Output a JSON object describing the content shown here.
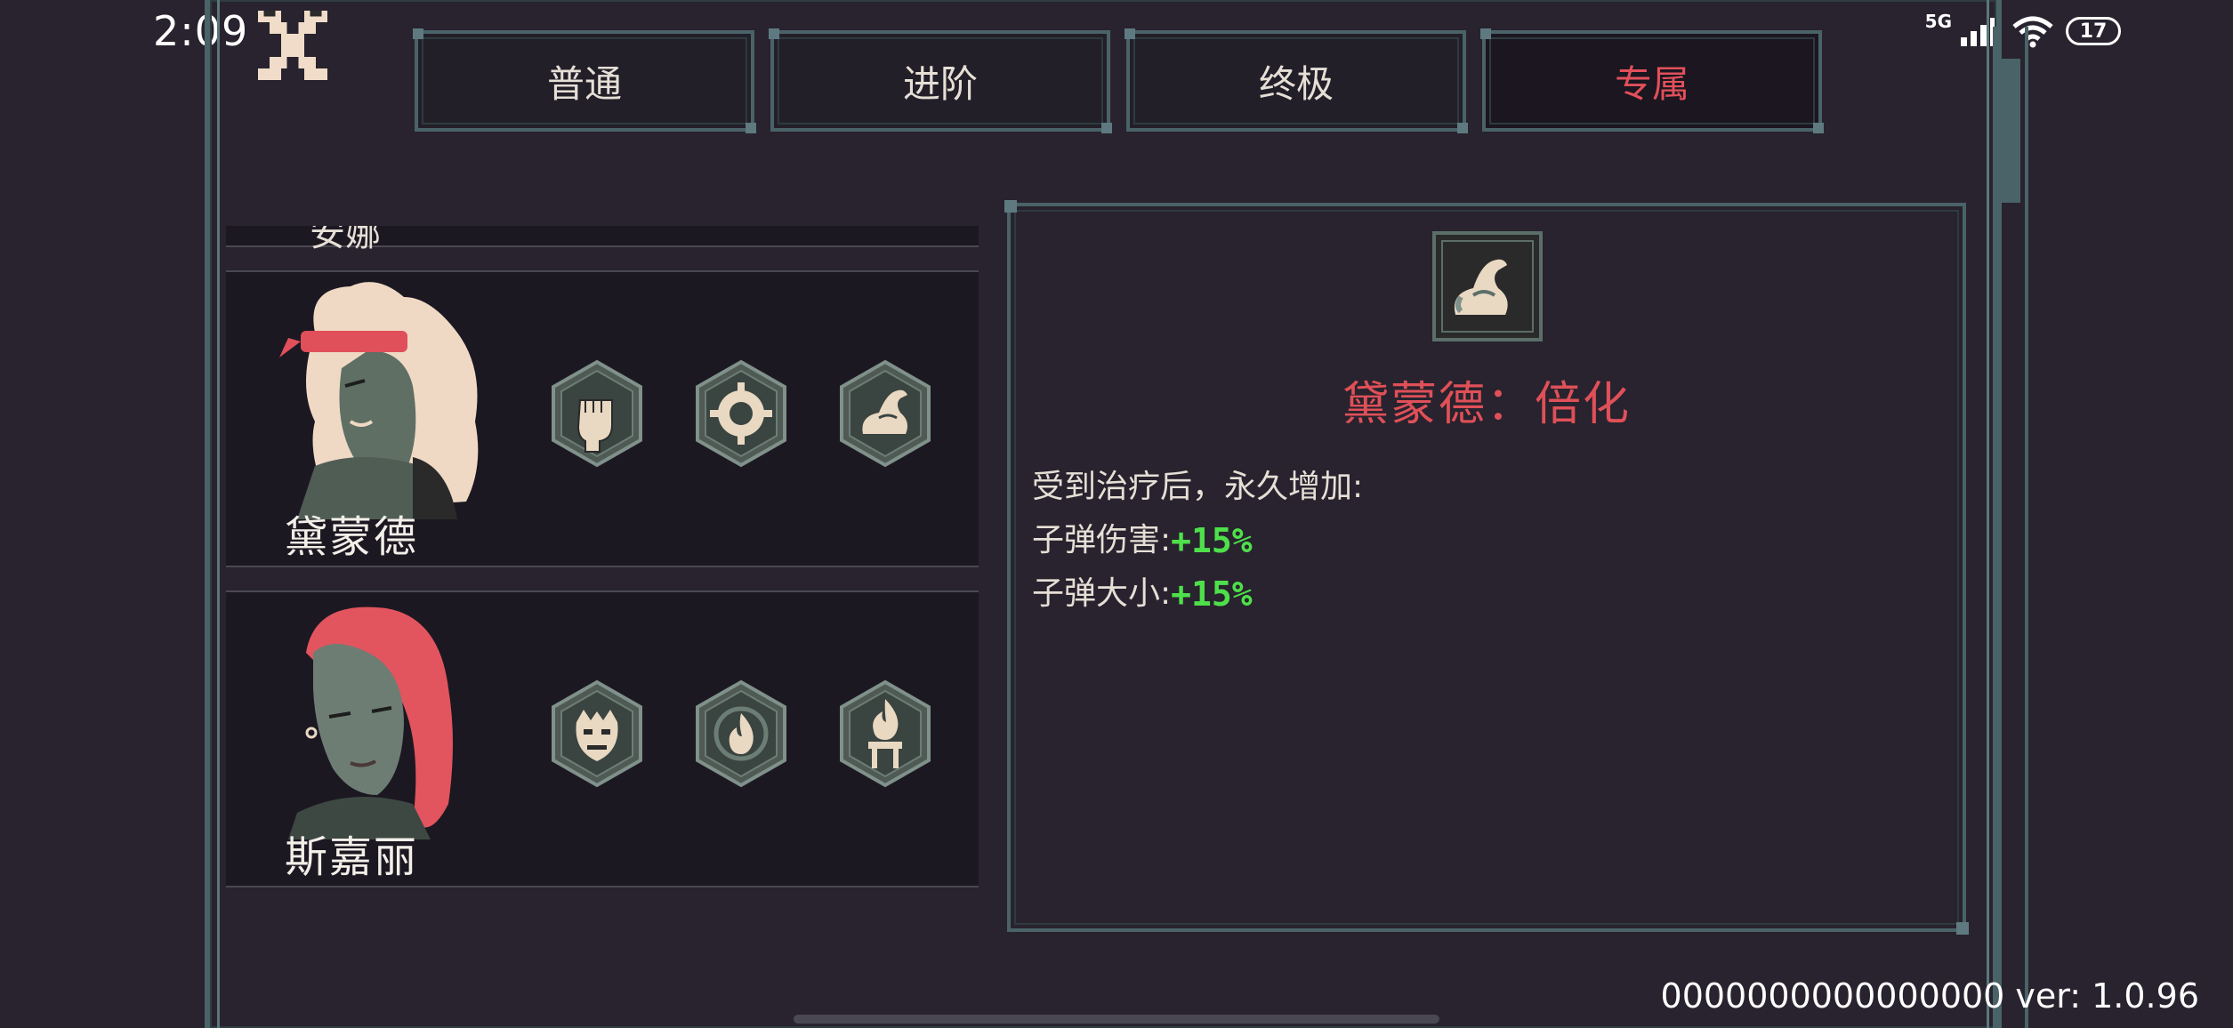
{
  "status_bar": {
    "time": "2:09",
    "network": "5G",
    "battery": "17"
  },
  "tabs": [
    {
      "label": "普通",
      "active": false
    },
    {
      "label": "进阶",
      "active": false
    },
    {
      "label": "终极",
      "active": false
    },
    {
      "label": "专属",
      "active": true
    }
  ],
  "characters": {
    "partial_name": "安娜",
    "rows": [
      {
        "name": "黛蒙德",
        "skill_icons": [
          "fist-icon",
          "spiked-ring-icon",
          "flexed-arm-icon"
        ]
      },
      {
        "name": "斯嘉丽",
        "skill_icons": [
          "demon-face-icon",
          "fire-circle-icon",
          "torch-icon"
        ]
      }
    ]
  },
  "detail": {
    "icon": "flexed-arm-icon",
    "title": "黛蒙德：倍化",
    "description": "受到治疗后，永久增加:",
    "stats": [
      {
        "label": "子弹伤害:",
        "value": "+15%"
      },
      {
        "label": "子弹大小:",
        "value": "+15%"
      }
    ]
  },
  "footer": {
    "version": "0000000000000000 ver: 1.0.96"
  },
  "colors": {
    "background": "#28232e",
    "border": "#4a6368",
    "accent_red": "#e05058",
    "stat_green": "#4ee04a"
  }
}
